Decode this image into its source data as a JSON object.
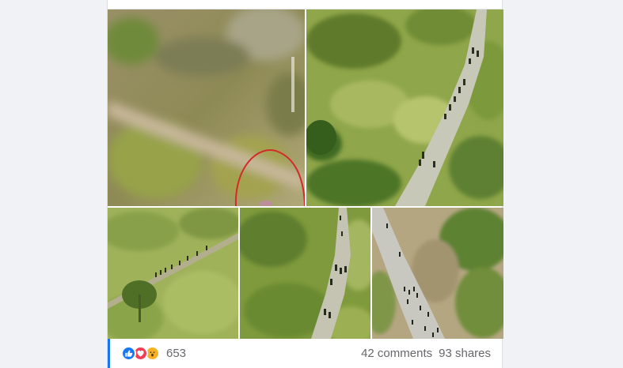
{
  "post": {
    "photos": [
      {
        "id": "photo-1",
        "alt": "drone-view-path-with-red-circle"
      },
      {
        "id": "photo-2",
        "alt": "drone-view-road-column"
      },
      {
        "id": "photo-3",
        "alt": "drone-view-diagonal-path"
      },
      {
        "id": "photo-4",
        "alt": "drone-view-narrow-path"
      },
      {
        "id": "photo-5",
        "alt": "drone-view-road-group"
      }
    ],
    "reactions": {
      "icons": [
        "like-icon",
        "love-icon",
        "wow-icon"
      ],
      "count": "653"
    },
    "comments_label": "42 comments",
    "shares_label": "93 shares"
  },
  "colors": {
    "accent": "#1877f2",
    "like": "#1877f2",
    "love": "#f33e58",
    "wow": "#f7b125",
    "muted_text": "#65676b",
    "circle_annotation": "#d62828"
  }
}
